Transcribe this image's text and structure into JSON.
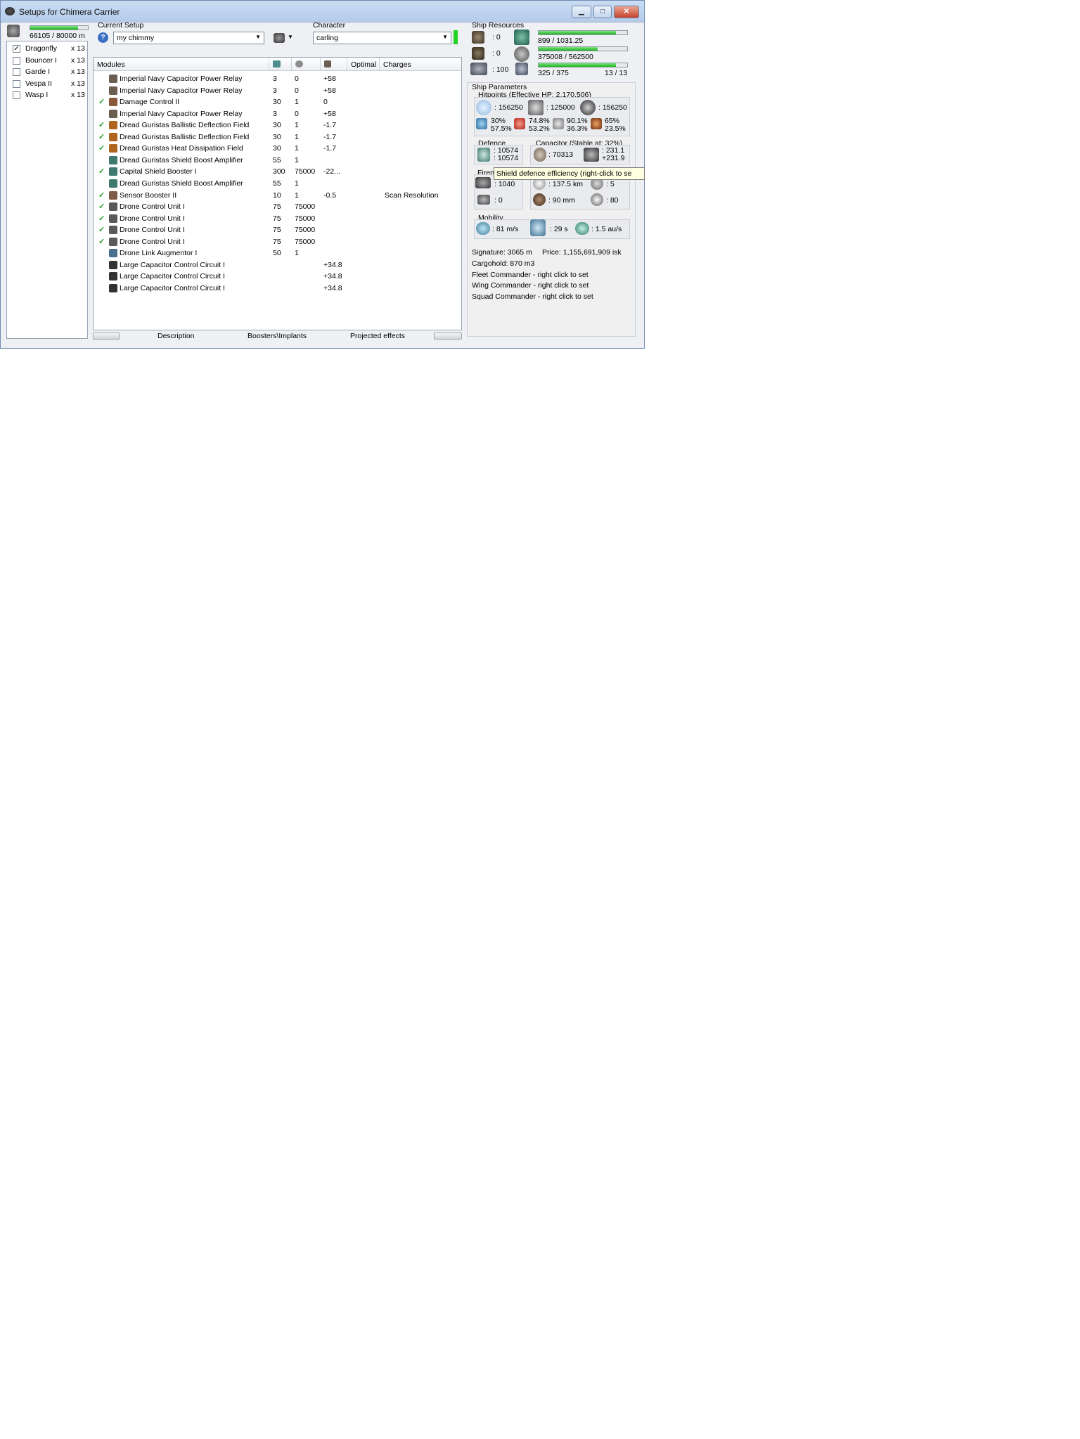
{
  "window": {
    "title": "Setups for Chimera Carrier",
    "buttons": [
      "minimize",
      "maximize",
      "close"
    ]
  },
  "drone_bay": {
    "capacity_text": "66105 / 80000 m",
    "fill_fraction": 0.83,
    "drones": [
      {
        "name": "Dragonfly",
        "qty": "x 13",
        "checked": true
      },
      {
        "name": "Bouncer I",
        "qty": "x 13",
        "checked": false
      },
      {
        "name": "Garde I",
        "qty": "x 13",
        "checked": false
      },
      {
        "name": "Vespa II",
        "qty": "x 13",
        "checked": false
      },
      {
        "name": "Wasp I",
        "qty": "x 13",
        "checked": false
      }
    ]
  },
  "setup": {
    "label": "Current Setup",
    "value": "my chimmy",
    "character_label": "Character",
    "character_value": "carling"
  },
  "modules": {
    "headers": {
      "name": "Modules",
      "optimal": "Optimal",
      "charges": "Charges"
    },
    "rows": [
      {
        "check": "",
        "name": "Imperial Navy Capacitor Power Relay",
        "cpu": "3",
        "pg": "0",
        "cap": "+58",
        "charges": "",
        "icon_color": "#6b5d4f"
      },
      {
        "check": "",
        "name": "Imperial Navy Capacitor Power Relay",
        "cpu": "3",
        "pg": "0",
        "cap": "+58",
        "charges": "",
        "icon_color": "#6b5d4f"
      },
      {
        "check": "✓",
        "name": "Damage Control II",
        "cpu": "30",
        "pg": "1",
        "cap": "0",
        "charges": "",
        "icon_color": "#8a5a3a"
      },
      {
        "check": "",
        "name": "Imperial Navy Capacitor Power Relay",
        "cpu": "3",
        "pg": "0",
        "cap": "+58",
        "charges": "",
        "icon_color": "#6b5d4f"
      },
      {
        "check": "✓",
        "name": "Dread Guristas Ballistic Deflection Field",
        "cpu": "30",
        "pg": "1",
        "cap": "-1.7",
        "charges": "",
        "icon_color": "#b0651e"
      },
      {
        "check": "✓",
        "name": "Dread Guristas Ballistic Deflection Field",
        "cpu": "30",
        "pg": "1",
        "cap": "-1.7",
        "charges": "",
        "icon_color": "#b0651e"
      },
      {
        "check": "✓",
        "name": "Dread Guristas Heat Dissipation Field",
        "cpu": "30",
        "pg": "1",
        "cap": "-1.7",
        "charges": "",
        "icon_color": "#b0651e"
      },
      {
        "check": "",
        "name": "Dread Guristas Shield Boost Amplifier",
        "cpu": "55",
        "pg": "1",
        "cap": "",
        "charges": "",
        "icon_color": "#3f7a6e"
      },
      {
        "check": "✓",
        "name": "Capital Shield Booster I",
        "cpu": "300",
        "pg": "75000",
        "cap": "-22...",
        "charges": "",
        "icon_color": "#3f7a6e"
      },
      {
        "check": "",
        "name": "Dread Guristas Shield Boost Amplifier",
        "cpu": "55",
        "pg": "1",
        "cap": "",
        "charges": "",
        "icon_color": "#3f7a6e"
      },
      {
        "check": "✓",
        "name": "Sensor Booster II",
        "cpu": "10",
        "pg": "1",
        "cap": "-0.5",
        "charges": "Scan Resolution",
        "icon_color": "#7d5b45"
      },
      {
        "check": "✓",
        "name": "Drone Control Unit I",
        "cpu": "75",
        "pg": "75000",
        "cap": "",
        "charges": "",
        "icon_color": "#5a5a5a"
      },
      {
        "check": "✓",
        "name": "Drone Control Unit I",
        "cpu": "75",
        "pg": "75000",
        "cap": "",
        "charges": "",
        "icon_color": "#5a5a5a"
      },
      {
        "check": "✓",
        "name": "Drone Control Unit I",
        "cpu": "75",
        "pg": "75000",
        "cap": "",
        "charges": "",
        "icon_color": "#5a5a5a"
      },
      {
        "check": "✓",
        "name": "Drone Control Unit I",
        "cpu": "75",
        "pg": "75000",
        "cap": "",
        "charges": "",
        "icon_color": "#5a5a5a"
      },
      {
        "check": "",
        "name": "Drone Link Augmentor I",
        "cpu": "50",
        "pg": "1",
        "cap": "",
        "charges": "",
        "icon_color": "#4d6f8f"
      },
      {
        "check": "",
        "name": "Large Capacitor Control Circuit I",
        "cpu": "",
        "pg": "",
        "cap": "+34.8",
        "charges": "",
        "icon_color": "#333333"
      },
      {
        "check": "",
        "name": "Large Capacitor Control Circuit I",
        "cpu": "",
        "pg": "",
        "cap": "+34.8",
        "charges": "",
        "icon_color": "#333333"
      },
      {
        "check": "",
        "name": "Large Capacitor Control Circuit I",
        "cpu": "",
        "pg": "",
        "cap": "+34.8",
        "charges": "",
        "icon_color": "#333333"
      }
    ]
  },
  "bottom_tabs": [
    "Description",
    "Boosters\\Implants",
    "Projected effects"
  ],
  "resources": {
    "label": "Ship Resources",
    "hardpoints": {
      "turret": ": 0",
      "launcher": ": 0",
      "drone": ": 100"
    },
    "cpu": {
      "text": "899 / 1031.25",
      "fraction": 0.87
    },
    "powergrid": {
      "text": "375008 / 562500",
      "fraction": 0.67
    },
    "calibration": {
      "text": "325 / 375",
      "fraction": 0.87,
      "slots": "13 / 13"
    }
  },
  "parameters": {
    "label": "Ship Parameters",
    "hitpoints_label": "Hitpoints (Effective HP: 2,170,506)",
    "hp": {
      "shield": ": 156250",
      "armor": ": 125000",
      "structure": ": 156250"
    },
    "resists": [
      {
        "a": "30%",
        "b": "57.5%"
      },
      {
        "a": "74.8%",
        "b": "53.2%"
      },
      {
        "a": "90.1%",
        "b": "36.3%"
      },
      {
        "a": "65%",
        "b": "23.5%"
      }
    ],
    "defence_label": "Defence",
    "defence": {
      "a": ": 10574",
      "b": ": 10574"
    },
    "capacitor_label": "Capacitor (Stable at: 32%)",
    "capacitor": {
      "amount": ": 70313",
      "a": ": 231.1",
      "b": "+231.9"
    },
    "firepower_label": "Firep",
    "firepower": {
      "dps": ": 1040",
      "range": ": 137.5 km",
      "targets": ": 5",
      "volley": ": 0",
      "scan": ": 90 mm",
      "res": ": 80"
    },
    "mobility_label": "Mobility",
    "mobility": {
      "speed": ": 81 m/s",
      "align": ": 29 s",
      "warp": ": 1.5 au/s"
    },
    "signature": "Signature: 3065 m",
    "price": "Price: 1,155,691,909 isk",
    "cargohold": "Cargohold: 870 m3",
    "fleet_commander": "Fleet Commander - right click to set",
    "wing_commander": "Wing Commander - right click to set",
    "squad_commander": "Squad Commander - right click to set"
  },
  "tooltip": "Shield defence efficiency (right-click to se",
  "colors": {
    "accent_green": "#1fb21f",
    "check_green": "#2aa02a",
    "titlebar": "#c9dcf3"
  }
}
